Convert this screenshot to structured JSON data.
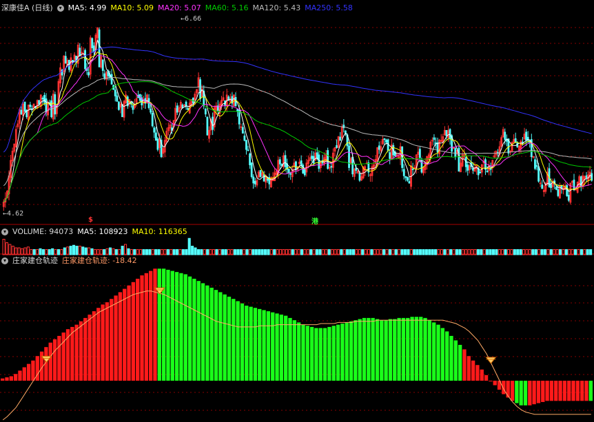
{
  "main_header": {
    "stock": "深康佳A (日线)",
    "ma5": "MA5: 4.99",
    "ma10": "MA10: 5.09",
    "ma20": "MA20: 5.07",
    "ma60": "MA60: 5.16",
    "ma120": "MA120: 5.43",
    "ma250": "MA250: 5.58"
  },
  "vol_header": {
    "volume": "VOLUME: 94073",
    "ma5": "MA5: 108923",
    "ma10": "MA10: 116365"
  },
  "ind_header": {
    "name": "庄家建仓轨迹",
    "value": "庄家建仓轨迹: -18.42"
  },
  "markers": {
    "high": "6.66",
    "low": "4.62",
    "event_s": "$",
    "event_gang": "港"
  },
  "colors": {
    "up": "#ff3333",
    "down": "#54ffff",
    "ma5": "#ffffff",
    "ma10": "#ffff00",
    "ma20": "#ff33ff",
    "ma60": "#00cc00",
    "ma120": "#bbbbbb",
    "ma250": "#3333ff",
    "grid": "#880000",
    "ind_up": "#ff1a1a",
    "ind_down": "#1aff1a",
    "trend": "#ffaa66"
  },
  "chart_data": [
    {
      "type": "candlestick",
      "title": "深康佳A (日线)",
      "price_range": [
        4.55,
        6.75
      ],
      "high": 6.66,
      "low": 4.62,
      "closes": [
        4.66,
        4.7,
        4.78,
        4.95,
        5.12,
        5.22,
        5.3,
        5.46,
        5.52,
        5.68,
        5.63,
        5.74,
        5.66,
        5.6,
        5.73,
        5.71,
        5.68,
        5.74,
        5.7,
        5.78,
        5.74,
        5.84,
        5.8,
        5.76,
        5.65,
        5.76,
        5.74,
        5.6,
        5.85,
        5.63,
        5.73,
        5.99,
        6.14,
        6.06,
        6.27,
        6.19,
        6.22,
        6.12,
        6.25,
        6.21,
        6.28,
        6.2,
        6.39,
        6.27,
        6.31,
        6.3,
        6.13,
        6.11,
        6.06,
        6.47,
        6.36,
        6.32,
        6.5,
        6.58,
        6.15,
        6.26,
        6.11,
        6.02,
        6.09,
        6.05,
        6.03,
        5.96,
        5.9,
        5.83,
        5.77,
        5.68,
        5.74,
        5.6,
        5.77,
        5.84,
        5.72,
        5.79,
        5.74,
        5.68,
        5.73,
        5.8,
        5.81,
        5.78,
        5.73,
        5.79,
        5.75,
        5.84,
        5.7,
        5.65,
        5.5,
        5.43,
        5.34,
        5.24,
        5.36,
        5.16,
        5.25,
        5.34,
        5.44,
        5.48,
        5.51,
        5.45,
        5.56,
        5.69,
        5.65,
        5.7,
        5.76,
        5.7,
        5.73,
        5.71,
        5.68,
        5.75,
        5.79,
        5.75,
        5.85,
        5.9,
        6.03,
        5.8,
        5.91,
        5.72,
        5.63,
        5.4,
        5.45,
        5.57,
        5.46,
        5.7,
        5.72,
        5.67,
        5.74,
        5.78,
        5.81,
        5.73,
        5.84,
        5.78,
        5.8,
        5.75,
        5.84,
        5.72,
        5.66,
        5.52,
        5.49,
        5.42,
        5.34,
        5.24,
        5.23,
        5.07,
        4.94,
        4.87,
        4.86,
        4.9,
        4.99,
        4.94,
        4.98,
        4.89,
        4.95,
        4.9,
        4.86,
        4.93,
        4.92,
        4.98,
        5.0,
        5.12,
        5.08,
        5.06,
        5.17,
        5.05,
        5.02,
        4.98,
        4.97,
        5.02,
        5.09,
        5.02,
        5.05,
        5.1,
        5.07,
        4.98,
        4.96,
        5.09,
        5.12,
        5.15,
        5.14,
        5.09,
        5.2,
        5.14,
        5.03,
        5.09,
        5.09,
        5.15,
        5.19,
        5.03,
        5.04,
        5.05,
        5.2,
        5.26,
        5.26,
        5.38,
        5.34,
        5.49,
        5.48,
        5.41,
        5.28,
        5.04,
        5.14,
        4.97,
        5.02,
        5.01,
        5.0,
        4.9,
        4.94,
        5.05,
        5.05,
        5.09,
        4.99,
        4.96,
        5.05,
        5.07,
        5.13,
        5.26,
        5.24,
        5.27,
        5.35,
        5.35,
        5.32,
        5.23,
        5.14,
        5.29,
        5.18,
        5.17,
        5.18,
        5.16,
        5.27,
        5.04,
        4.95,
        4.93,
        4.9,
        4.87,
        5.06,
        5.02,
        5.04,
        5.18,
        5.21,
        5.15,
        4.99,
        5.04,
        5.08,
        5.16,
        5.18,
        5.32,
        5.34,
        5.35,
        5.31,
        5.21,
        5.34,
        5.34,
        5.38,
        5.45,
        5.39,
        5.45,
        5.36,
        5.22,
        5.26,
        5.16,
        5.23,
        5.0,
        5.09,
        5.18,
        5.18,
        5.05,
        5.01,
        5.06,
        5.05,
        5.01,
        5.04,
        5.06,
        4.96,
        4.98,
        5.07,
        5.11,
        5.02,
        5.0,
        5.06,
        5.02,
        5.12,
        5.17,
        5.22,
        5.2,
        5.27,
        5.37,
        5.46,
        5.35,
        5.33,
        5.2,
        5.22,
        5.32,
        5.35,
        5.32,
        5.27,
        5.28,
        5.33,
        5.32,
        5.41,
        5.34,
        5.34,
        5.32,
        5.16,
        5.16,
        5.03,
        5.06,
        4.89,
        4.87,
        4.81,
        4.79,
        4.87,
        4.99,
        4.83,
        4.82,
        4.89,
        4.86,
        4.8,
        4.73,
        4.84,
        4.81,
        4.82,
        4.84,
        4.73,
        4.68,
        4.87,
        4.89,
        4.8,
        4.8,
        4.88,
        4.94,
        4.84,
        4.95,
        4.94,
        4.93,
        4.96,
        4.99,
        4.9
      ]
    },
    {
      "type": "bar",
      "title": "VOLUME",
      "values_relative": [
        0.9,
        0.7,
        0.6,
        0.5,
        0.4,
        0.4,
        0.35,
        0.4,
        0.45,
        0.3,
        0.3,
        0.3,
        0.35,
        0.3,
        0.3,
        0.3,
        0.35,
        0.3,
        0.3,
        0.3,
        0.4,
        0.45,
        0.5,
        0.55,
        0.5,
        0.5,
        0.45,
        0.4,
        0.4,
        0.35,
        0.3,
        0.3,
        0.3,
        0.3,
        0.35,
        0.4,
        0.35,
        0.3,
        0.3,
        0.5,
        0.6,
        0.35,
        0.3,
        0.3,
        0.3,
        0.3,
        0.3,
        0.3,
        0.3,
        0.3,
        0.3,
        0.3,
        0.3,
        0.3,
        0.3,
        0.3,
        0.3,
        0.3,
        0.3,
        0.3,
        0.3,
        0.95,
        0.5,
        0.4,
        0.3,
        0.3,
        0.3,
        0.3,
        0.3,
        0.3,
        0.3,
        0.3,
        0.3,
        0.3,
        0.3,
        0.3,
        0.3,
        0.3,
        0.3,
        0.3,
        0.3,
        0.3,
        0.3,
        0.3,
        0.3,
        0.3,
        0.3,
        0.3,
        0.3,
        0.3,
        0.3,
        0.3,
        0.3,
        0.3,
        0.3,
        0.3,
        0.3,
        0.3,
        0.3,
        0.3,
        0.3,
        0.3,
        0.3,
        0.3,
        0.3,
        0.3,
        0.3,
        0.3,
        0.3,
        0.3,
        0.3,
        0.3,
        0.3,
        0.3,
        0.3,
        0.3,
        0.3,
        0.3,
        0.3,
        0.3,
        0.3,
        0.3,
        0.3,
        0.3,
        0.3,
        0.3,
        0.3,
        0.3,
        0.3,
        0.3,
        0.3,
        0.3,
        0.3,
        0.3,
        0.3,
        0.3,
        0.3,
        0.3,
        0.3,
        0.3,
        0.3,
        0.3,
        0.3,
        0.3,
        0.3,
        0.3,
        0.3,
        0.3,
        0.3,
        0.3,
        0.3,
        0.3,
        0.3,
        0.3,
        0.3,
        0.3,
        0.3,
        0.3,
        0.3,
        0.3,
        0.3,
        0.3,
        0.3,
        0.3,
        0.3,
        0.3,
        0.3,
        0.3,
        0.3,
        0.3,
        0.3,
        0.3,
        0.3,
        0.3,
        0.3,
        0.3,
        0.3,
        0.3,
        0.3,
        0.3,
        0.3,
        0.3,
        0.3,
        0.3,
        0.3,
        0.3,
        0.3,
        0.3,
        0.3,
        0.3,
        0.3,
        0.3,
        0.3,
        0.3
      ]
    },
    {
      "type": "bar",
      "title": "庄家建仓轨迹",
      "value": -18.42,
      "range": [
        -35,
        102
      ],
      "bars": [
        2,
        3,
        4,
        6,
        9,
        12,
        15,
        18,
        22,
        26,
        30,
        34,
        37,
        40,
        43,
        46,
        48,
        50,
        53,
        56,
        59,
        62,
        65,
        68,
        70,
        73,
        76,
        79,
        82,
        85,
        88,
        91,
        94,
        96,
        98,
        100,
        100,
        100,
        99,
        98,
        97,
        96,
        95,
        93,
        91,
        89,
        87,
        85,
        83,
        81,
        79,
        77,
        75,
        73,
        71,
        69,
        67,
        66,
        65,
        64,
        63,
        62,
        61,
        60,
        59,
        58,
        56,
        54,
        52,
        50,
        49,
        48,
        47,
        47,
        47,
        48,
        49,
        50,
        51,
        52,
        53,
        54,
        55,
        56,
        56,
        56,
        55,
        54,
        54,
        55,
        55,
        56,
        56,
        56,
        57,
        57,
        57,
        56,
        54,
        52,
        50,
        47,
        44,
        40,
        36,
        32,
        28,
        22,
        18,
        14,
        10,
        5,
        0,
        -4,
        -8,
        -12,
        -15,
        -18,
        -20,
        -22,
        -22,
        -22,
        -21,
        -20,
        -19,
        -18,
        -18,
        -18,
        -18,
        -18,
        -18,
        -18,
        -18,
        -18,
        -18,
        -18
      ],
      "bar_colors": "rrrrrrrrrrrrrrrrrrrrrrrrrrrrrrrrrrrrggggggggggggggggggggggggggggggggggggggggggggggggggggggggggggggggggggggrrrrrrrrrrrrgggrrrrrrrrrrrrrrggggggggggggggggggggggggrrrrrrrrrrrrr",
      "trend": [
        -35,
        -32,
        -28,
        -24,
        -18,
        -12,
        -6,
        0,
        6,
        12,
        17,
        22,
        27,
        31,
        35,
        39,
        43,
        46,
        49,
        52,
        55,
        58,
        61,
        63,
        65,
        67,
        69,
        71,
        73,
        75,
        77,
        78,
        79,
        80,
        80,
        79,
        78,
        77,
        75,
        73,
        71,
        69,
        67,
        65,
        63,
        61,
        59,
        57,
        55,
        53,
        52,
        51,
        50,
        49,
        48,
        48,
        48,
        48,
        48,
        49,
        49,
        49,
        49,
        50,
        50,
        50,
        50,
        50,
        50,
        50,
        50,
        50,
        50,
        51,
        51,
        51,
        51,
        52,
        52,
        52,
        52,
        53,
        53,
        53,
        53,
        53,
        54,
        54,
        54,
        54,
        54,
        54,
        54,
        54,
        54,
        54,
        54,
        54,
        54,
        54,
        54,
        54,
        53,
        52,
        51,
        49,
        47,
        44,
        40,
        36,
        30,
        24,
        16,
        8,
        0,
        -8,
        -14,
        -19,
        -23,
        -26,
        -28,
        -29,
        -30,
        -30,
        -30,
        -30,
        -30,
        -30,
        -30,
        -30,
        -30,
        -30,
        -30,
        -30,
        -30,
        -30
      ],
      "diamonds_at": [
        10,
        36,
        112
      ]
    }
  ]
}
